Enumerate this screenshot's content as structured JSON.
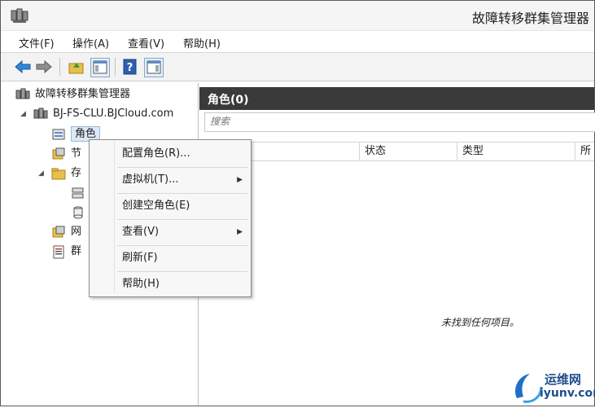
{
  "window": {
    "title": "故障转移群集管理器"
  },
  "menubar": {
    "items": [
      "文件(F)",
      "操作(A)",
      "查看(V)",
      "帮助(H)"
    ]
  },
  "toolbar": {
    "icons": [
      "back-arrow-icon",
      "forward-arrow-icon",
      "folder-up-icon",
      "show-hide-tree-icon",
      "help-icon",
      "show-hide-action-pane-icon"
    ]
  },
  "tree": {
    "root": "故障转移群集管理器",
    "cluster": "BJ-FS-CLU.BJCloud.com",
    "roles": "角色",
    "nodes": "节",
    "storage": "存",
    "network": "网",
    "events": "群"
  },
  "right_pane": {
    "header": "角色(0)",
    "search_placeholder": "搜索",
    "columns": [
      "状态",
      "类型",
      "所"
    ],
    "empty_message": "未找到任何项目。"
  },
  "context_menu": {
    "items": [
      {
        "label": "配置角色(R)...",
        "submenu": false
      },
      {
        "label": "虚拟机(T)...",
        "submenu": true
      },
      {
        "label": "创建空角色(E)",
        "submenu": false
      },
      {
        "label": "查看(V)",
        "submenu": true
      },
      {
        "label": "刷新(F)",
        "submenu": false
      },
      {
        "label": "帮助(H)",
        "submenu": false
      }
    ]
  },
  "watermark": {
    "line1": "运维网",
    "line2": "iyunv.com"
  },
  "colors": {
    "header_bar": "#3a3a3a",
    "selection": "#dbe8f5",
    "accent_blue": "#1f6fc5"
  }
}
